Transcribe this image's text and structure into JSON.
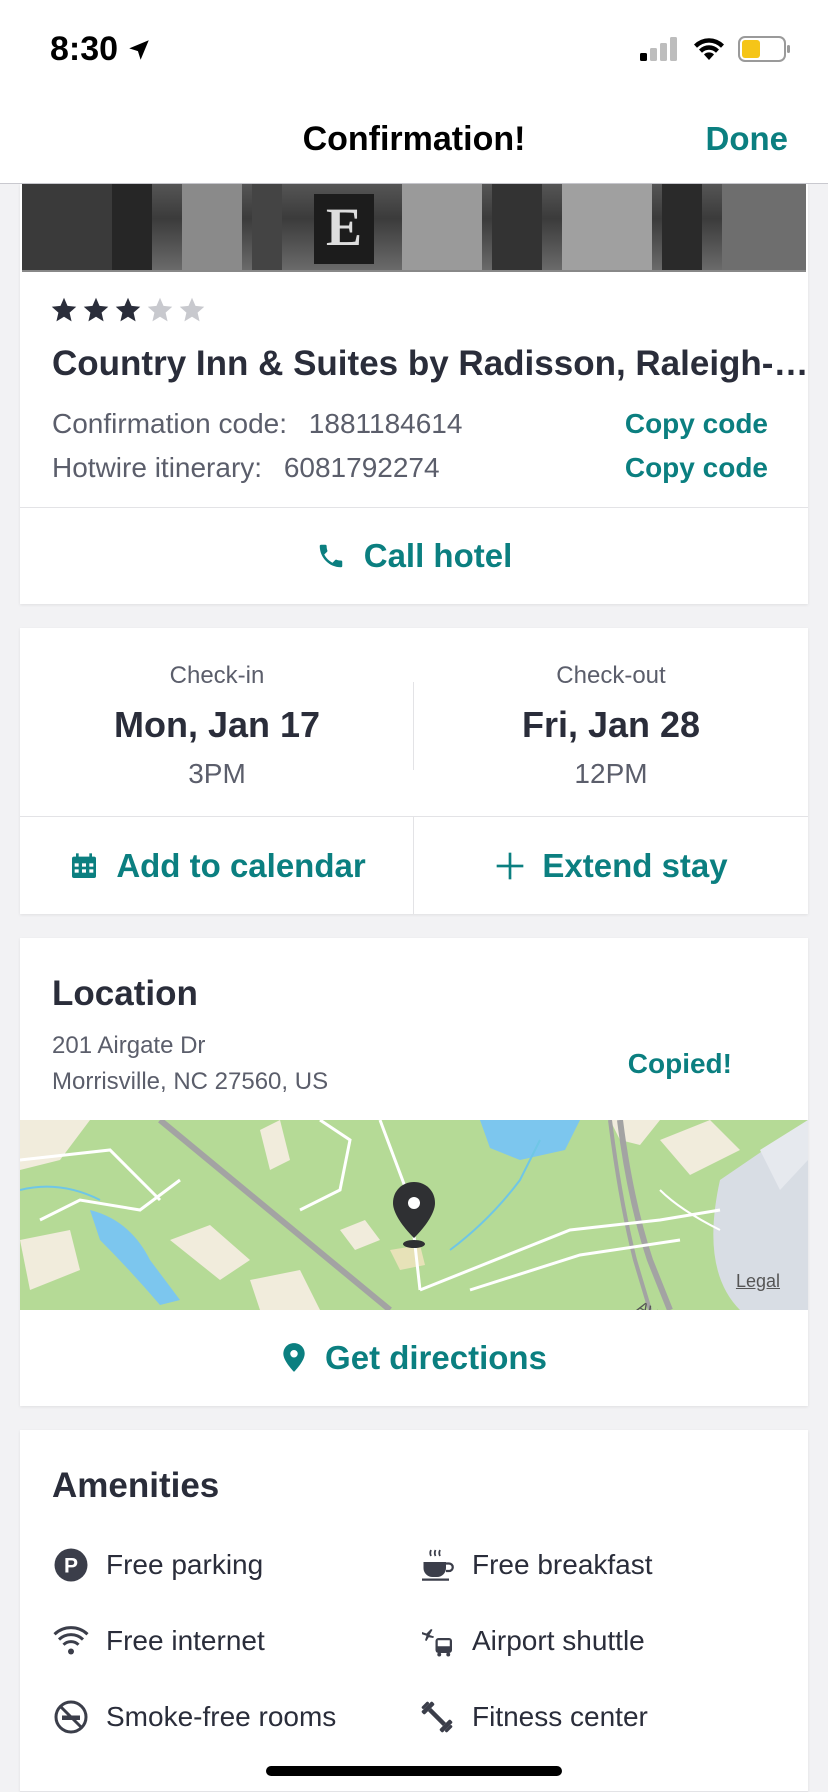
{
  "status_bar": {
    "time": "8:30"
  },
  "nav": {
    "title": "Confirmation!",
    "done_label": "Done"
  },
  "hotel": {
    "rating": 3,
    "max_rating": 5,
    "name": "Country Inn & Suites by Radisson, Raleigh-…",
    "photo_sign": "E",
    "confirmation_label": "Confirmation code:",
    "confirmation_code": "1881184614",
    "itinerary_label": "Hotwire itinerary:",
    "itinerary_code": "6081792274",
    "copy_label": "Copy code",
    "call_label": "Call hotel"
  },
  "stay": {
    "checkin_label": "Check-in",
    "checkin_date": "Mon, Jan 17",
    "checkin_time": "3PM",
    "checkout_label": "Check-out",
    "checkout_date": "Fri, Jan 28",
    "checkout_time": "12PM",
    "add_calendar_label": "Add to calendar",
    "extend_label": "Extend stay"
  },
  "location": {
    "title": "Location",
    "address_line1": "201 Airgate Dr",
    "address_line2": "Morrisville, NC 27560, US",
    "copied_label": "Copied!",
    "map_legal": "Legal",
    "map_road_label": "AV",
    "directions_label": "Get directions"
  },
  "amenities": {
    "title": "Amenities",
    "items": [
      {
        "label": "Free parking",
        "icon": "parking-icon"
      },
      {
        "label": "Free breakfast",
        "icon": "coffee-icon"
      },
      {
        "label": "Free internet",
        "icon": "wifi-icon"
      },
      {
        "label": "Airport shuttle",
        "icon": "shuttle-icon"
      },
      {
        "label": "Smoke-free rooms",
        "icon": "no-smoking-icon"
      },
      {
        "label": "Fitness center",
        "icon": "dumbbell-icon"
      }
    ]
  },
  "colors": {
    "accent": "#0b7f80",
    "text": "#2a2d3a",
    "muted": "#5b5e6b",
    "battery": "#f5c518"
  }
}
